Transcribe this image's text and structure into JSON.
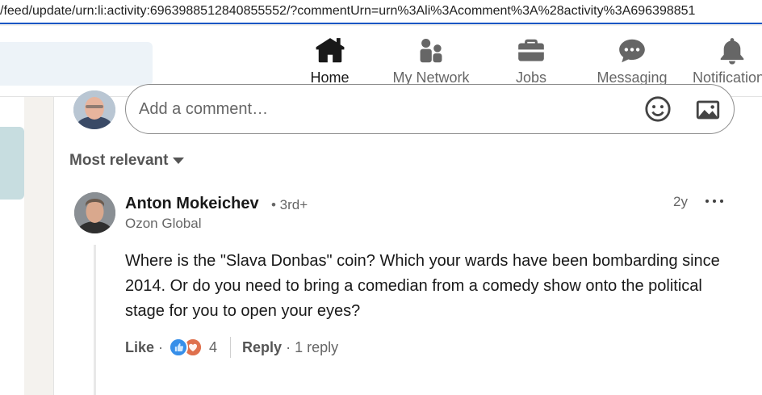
{
  "browser": {
    "url": "/feed/update/urn:li:activity:6963988512840855552/?commentUrn=urn%3Ali%3Acomment%3A%28activity%3A696398851"
  },
  "nav": {
    "items": [
      {
        "label": "Home",
        "icon": "home-icon",
        "active": true
      },
      {
        "label": "My Network",
        "icon": "network-icon"
      },
      {
        "label": "Jobs",
        "icon": "briefcase-icon"
      },
      {
        "label": "Messaging",
        "icon": "messaging-icon"
      },
      {
        "label": "Notifications",
        "icon": "bell-icon"
      }
    ]
  },
  "composer": {
    "placeholder": "Add a comment…",
    "emoji_icon": "emoji-icon",
    "photo_icon": "photo-icon"
  },
  "sort": {
    "label": "Most relevant"
  },
  "comment": {
    "author": "Anton Mokeichev",
    "degree": "• 3rd+",
    "company": "Ozon Global",
    "time": "2y",
    "text": "Where is the \"Slava Donbas\" coin? Which your wards have been bombarding since 2014. Or do you need to bring a comedian from a comedy show onto the political stage for you to open your eyes?",
    "like_label": "Like",
    "dot": "·",
    "reaction_count": "4",
    "reply_label": "Reply",
    "replies_label": "· 1 reply"
  },
  "colors": {
    "accent_line": "#1a56c4",
    "like_blue": "#378fe9",
    "love_red": "#df704d",
    "search_bg": "#edf3f8"
  }
}
